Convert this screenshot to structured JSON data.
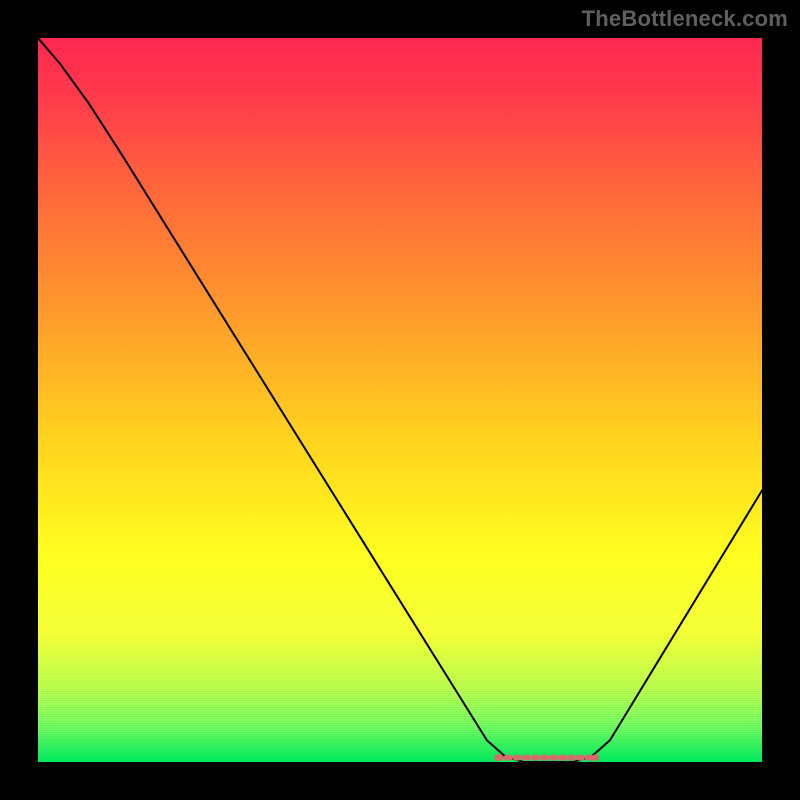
{
  "watermark": "TheBottleneck.com",
  "chart_data": {
    "type": "line",
    "title": "",
    "xlabel": "",
    "ylabel": "",
    "xlim": [
      0,
      100
    ],
    "ylim": [
      0,
      100
    ],
    "gradient_stops": [
      {
        "offset": 0.0,
        "color": "#ff2850"
      },
      {
        "offset": 0.08,
        "color": "#ff3a4c"
      },
      {
        "offset": 0.22,
        "color": "#ff6a3a"
      },
      {
        "offset": 0.38,
        "color": "#ff9a2c"
      },
      {
        "offset": 0.55,
        "color": "#ffd21e"
      },
      {
        "offset": 0.72,
        "color": "#ffff20"
      },
      {
        "offset": 0.82,
        "color": "#f3ff3a"
      },
      {
        "offset": 0.9,
        "color": "#c8ff55"
      },
      {
        "offset": 0.95,
        "color": "#86ff66"
      },
      {
        "offset": 1.0,
        "color": "#00e860"
      }
    ],
    "band_top_fraction": 0.815,
    "series": [
      {
        "name": "bottleneck-curve",
        "stroke": "#000000",
        "stroke_width": 2.0,
        "points": [
          {
            "x": 0.0,
            "y": 100.0
          },
          {
            "x": 3.0,
            "y": 96.5
          },
          {
            "x": 7.0,
            "y": 91.0
          },
          {
            "x": 11.5,
            "y": 84.0
          },
          {
            "x": 62.0,
            "y": 3.0
          },
          {
            "x": 64.5,
            "y": 0.8
          },
          {
            "x": 67.0,
            "y": 0.0
          },
          {
            "x": 74.0,
            "y": 0.0
          },
          {
            "x": 76.5,
            "y": 0.8
          },
          {
            "x": 79.0,
            "y": 3.0
          },
          {
            "x": 100.0,
            "y": 37.5
          }
        ]
      }
    ],
    "flat_marker": {
      "color": "#d76a6a",
      "stroke_width": 6.0,
      "cap_radius": 3.5,
      "y": 0.6,
      "x_start": 63.5,
      "x_end": 77.0
    }
  }
}
